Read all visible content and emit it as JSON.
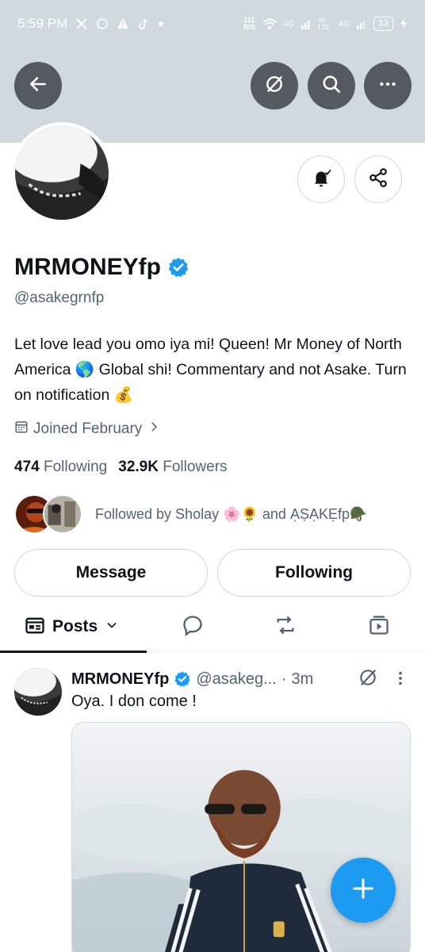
{
  "status_bar": {
    "time": "5:59 PM",
    "net_speed_value": "111",
    "net_speed_unit": "B/S",
    "signal_1": "4G",
    "signal_2": "4G",
    "volte": "Vo LTE",
    "battery": "33"
  },
  "colors": {
    "banner": "#cfd9de",
    "accent": "#1d9bf0",
    "text_primary": "#0f1419",
    "text_secondary": "#536471"
  },
  "profile": {
    "display_name": "MRMONEYfp",
    "handle": "@asakegrnfp",
    "bio": "Let love lead you omo iya mi! Queen! Mr Money of North America 🌎 Global shi! Commentary and not Asake. Turn on notification 💰",
    "joined": "Joined February",
    "following_count": "474",
    "following_label": "Following",
    "followers_count": "32.9K",
    "followers_label": "Followers",
    "followed_by": "Followed by Sholay 🌸🌻 and ẠṢẠKẸfp🪖"
  },
  "actions": {
    "message": "Message",
    "following": "Following"
  },
  "tabs": {
    "posts": "Posts"
  },
  "post": {
    "name": "MRMONEYfp",
    "handle": "@asakeg...",
    "time": "3m",
    "separator": "·",
    "text": "Oya. I don come !"
  },
  "icons": [
    "back-icon",
    "grok-icon",
    "search-icon",
    "more-icon",
    "notification-bell-icon",
    "share-icon",
    "verified-icon",
    "calendar-icon",
    "chevron-right-icon",
    "posts-icon",
    "chevron-down-icon",
    "reply-icon",
    "repost-icon",
    "media-icon",
    "compose-plus-icon"
  ]
}
